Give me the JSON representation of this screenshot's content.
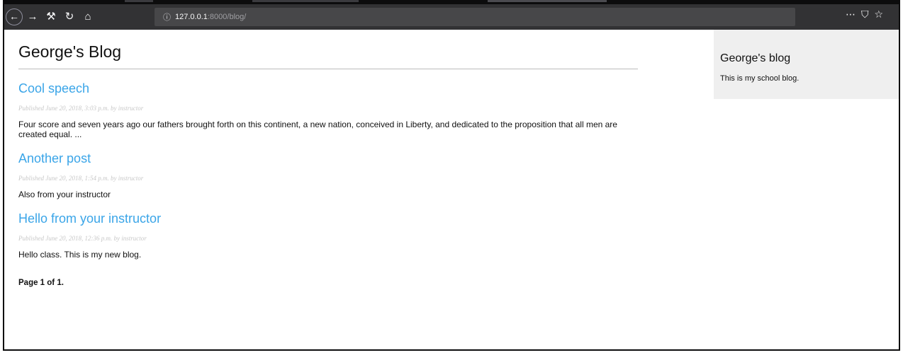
{
  "browser": {
    "url_host": "127.0.0.1",
    "url_rest": ":8000/blog/",
    "icons": {
      "back": "back-arrow-icon",
      "forward": "forward-arrow-icon",
      "tools": "wrench-icon",
      "reload": "reload-icon",
      "home": "home-icon",
      "info": "info-icon",
      "more": "more-dots-icon",
      "pocket": "pocket-icon",
      "bookmark": "star-icon"
    }
  },
  "blog": {
    "title": "George's Blog",
    "posts": [
      {
        "title": "Cool speech",
        "meta": "Published June 20, 2018, 3:03 p.m. by instructor",
        "body": "Four score and seven years ago our fathers brought forth on this continent, a new nation, conceived in Liberty, and dedicated to the proposition that all men are created equal. ..."
      },
      {
        "title": "Another post",
        "meta": "Published June 20, 2018, 1:54 p.m. by instructor",
        "body": "Also from your instructor"
      },
      {
        "title": "Hello from your instructor",
        "meta": "Published June 20, 2018, 12:36 p.m. by instructor",
        "body": "Hello class. This is my new blog."
      }
    ],
    "pagination": "Page 1 of 1."
  },
  "sidebar": {
    "title": "George's blog",
    "description": "This is my school blog."
  },
  "colors": {
    "link": "#3aa5e8",
    "toolbar": "#323234",
    "sidebar_bg": "#efefef"
  }
}
